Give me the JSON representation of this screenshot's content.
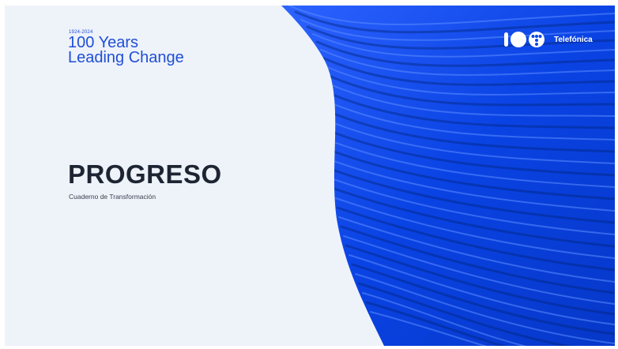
{
  "slide": {
    "tag": "1924-2024",
    "headline_line1": "100 Years",
    "headline_line2": "Leading Change",
    "title": "PROGRESO",
    "subtitle": "Cuaderno de Transformación"
  },
  "logo": {
    "mark_icon": "telefonica-100-logo-icon",
    "text": "Telefónica"
  },
  "colors": {
    "background": "#eef2f9",
    "brand_blue": "#1f4fd6",
    "wave_blue": "#0b46e6",
    "title_text": "#1e2532"
  }
}
